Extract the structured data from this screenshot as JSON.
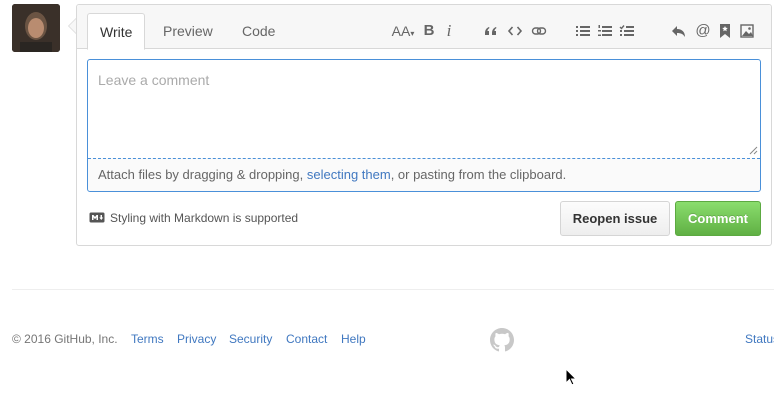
{
  "tabs": [
    {
      "label": "Write",
      "selected": true
    },
    {
      "label": "Preview",
      "selected": false
    },
    {
      "label": "Code",
      "selected": false
    }
  ],
  "toolbar": {
    "icons": [
      "text-size-icon",
      "bold-icon",
      "italic-icon",
      "quote-icon",
      "code-icon",
      "link-icon",
      "unordered-list-icon",
      "ordered-list-icon",
      "task-list-icon",
      "reply-icon",
      "mention-icon",
      "bookmark-icon",
      "image-icon"
    ],
    "text_size_label": "AA",
    "bold_label": "B",
    "italic_label": "i",
    "mention_label": "@"
  },
  "comment": {
    "placeholder": "Leave a comment",
    "value": "",
    "attach_prefix": "Attach files by dragging & dropping, ",
    "attach_link": "selecting them",
    "attach_suffix": ", or pasting from the clipboard."
  },
  "markdown_hint": "Styling with Markdown is supported",
  "buttons": {
    "reopen": "Reopen issue",
    "comment": "Comment"
  },
  "footer": {
    "copyright": "© 2016 GitHub, Inc.",
    "links": [
      "Terms",
      "Privacy",
      "Security",
      "Contact",
      "Help"
    ],
    "status": "Status"
  },
  "colors": {
    "link": "#4078c0",
    "focus_border": "#4a90d9",
    "comment_button": "#6cc644"
  }
}
